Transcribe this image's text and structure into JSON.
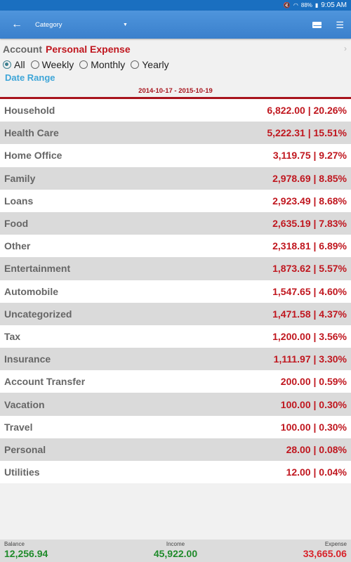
{
  "status_bar": {
    "battery": "88%",
    "time": "9:05 AM",
    "icons": [
      "mute-vibrate-icon",
      "wifi-icon",
      "battery-icon"
    ]
  },
  "app_bar": {
    "back_icon": "arrow-left-icon",
    "title": "Category",
    "dropdown_icon": "caret-down-icon",
    "mail_icon": "mail-icon",
    "list_icon": "list-icon"
  },
  "header": {
    "account_label": "Account",
    "account_name": "Personal Expense",
    "radios": [
      {
        "label": "All",
        "checked": true
      },
      {
        "label": "Weekly",
        "checked": false
      },
      {
        "label": "Monthly",
        "checked": false
      },
      {
        "label": "Yearly",
        "checked": false
      }
    ],
    "date_range_label": "Date Range",
    "date_span": "2014-10-17 - 2015-10-19"
  },
  "categories": [
    {
      "name": "Household",
      "value": "6,822.00 | 20.26%"
    },
    {
      "name": "Health Care",
      "value": "5,222.31 | 15.51%"
    },
    {
      "name": "Home Office",
      "value": "3,119.75 | 9.27%"
    },
    {
      "name": "Family",
      "value": "2,978.69 | 8.85%"
    },
    {
      "name": "Loans",
      "value": "2,923.49 | 8.68%"
    },
    {
      "name": "Food",
      "value": "2,635.19 | 7.83%"
    },
    {
      "name": "Other",
      "value": "2,318.81 | 6.89%"
    },
    {
      "name": "Entertainment",
      "value": "1,873.62 | 5.57%"
    },
    {
      "name": "Automobile",
      "value": "1,547.65 | 4.60%"
    },
    {
      "name": "Uncategorized",
      "value": "1,471.58 | 4.37%"
    },
    {
      "name": "Tax",
      "value": "1,200.00 | 3.56%"
    },
    {
      "name": "Insurance",
      "value": "1,111.97 | 3.30%"
    },
    {
      "name": "Account Transfer",
      "value": "200.00 | 0.59%"
    },
    {
      "name": "Vacation",
      "value": "100.00 | 0.30%"
    },
    {
      "name": "Travel",
      "value": "100.00 | 0.30%"
    },
    {
      "name": "Personal",
      "value": "28.00 | 0.08%"
    },
    {
      "name": "Utilities",
      "value": "12.00 | 0.04%"
    }
  ],
  "footer": {
    "balance_label": "Balance",
    "balance": "12,256.94",
    "income_label": "Income",
    "income": "45,922.00",
    "expense_label": "Expense",
    "expense": "33,665.06"
  },
  "colors": {
    "primary": "#3a80cc",
    "accent_red": "#c0171f",
    "income_green": "#1f8b2a",
    "link_blue": "#3fa6d8"
  }
}
